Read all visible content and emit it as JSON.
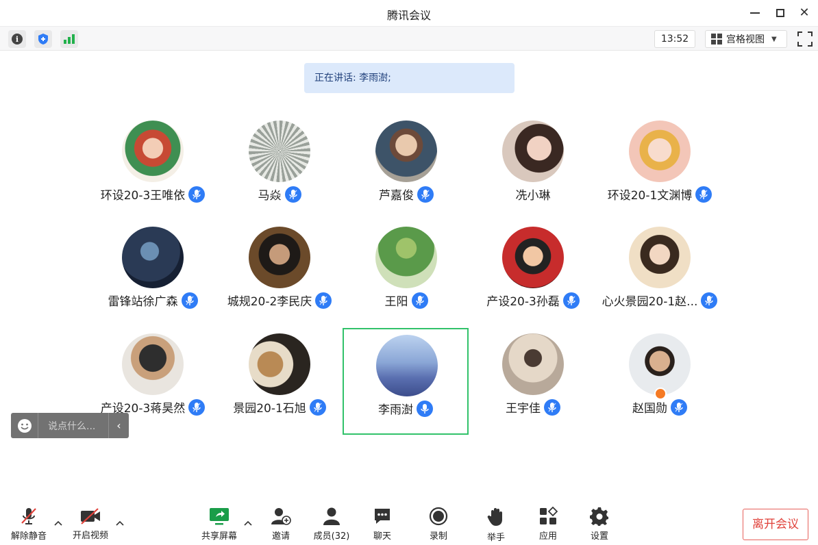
{
  "window": {
    "title": "腾讯会议"
  },
  "toolbar": {
    "time": "13:52",
    "view_label": "宫格视图"
  },
  "speaking": {
    "text": "正在讲话: 李雨澍;"
  },
  "participants": [
    {
      "name": "环设20-3王唯依",
      "mic": "on"
    },
    {
      "name": "马焱",
      "mic": "on"
    },
    {
      "name": "芦嘉俊",
      "mic": "on"
    },
    {
      "name": "冼小琳",
      "mic": "none"
    },
    {
      "name": "环设20-1文渊博",
      "mic": "on"
    },
    {
      "name": "雷锋站徐广森",
      "mic": "on"
    },
    {
      "name": "城规20-2李民庆",
      "mic": "on"
    },
    {
      "name": "王阳",
      "mic": "on"
    },
    {
      "name": "产设20-3孙磊",
      "mic": "on"
    },
    {
      "name": "心火景园20-1赵...",
      "mic": "on"
    },
    {
      "name": "产设20-3蒋昊然",
      "mic": "on"
    },
    {
      "name": "景园20-1石旭",
      "mic": "on"
    },
    {
      "name": "李雨澍",
      "mic": "speaking",
      "active": true
    },
    {
      "name": "王宇佳",
      "mic": "on"
    },
    {
      "name": "赵国勋",
      "mic": "on",
      "host": true
    }
  ],
  "chat": {
    "placeholder": "说点什么..."
  },
  "bottom_bar": {
    "unmute": "解除静音",
    "start_video": "开启视频",
    "share_screen": "共享屏幕",
    "invite": "邀请",
    "members": "成员(32)",
    "chat": "聊天",
    "record": "录制",
    "raise_hand": "举手",
    "apps": "应用",
    "settings": "设置",
    "leave": "离开会议"
  },
  "colors": {
    "accent": "#2f7cf6",
    "active_border": "#31c26a",
    "leave": "#e0413a",
    "banner": "#dce9fb"
  }
}
